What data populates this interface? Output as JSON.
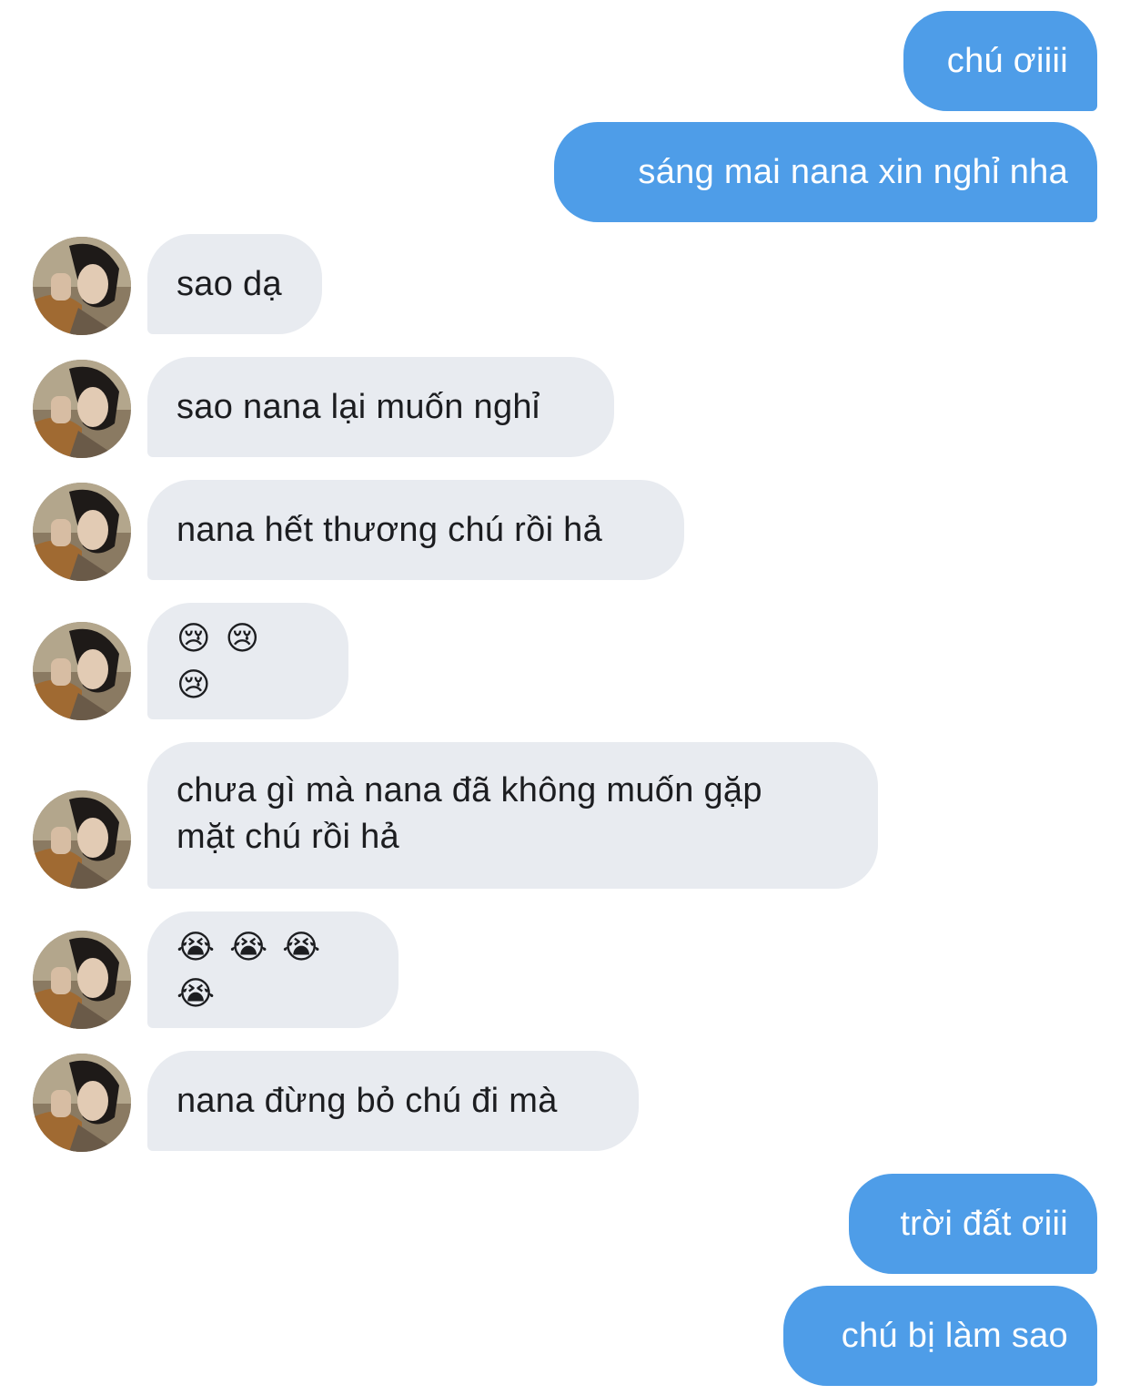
{
  "messages": [
    {
      "side": "sent",
      "text": "chú ơiiii"
    },
    {
      "side": "sent",
      "text": "sáng mai nana xin nghỉ nha"
    },
    {
      "side": "received",
      "text": "sao dạ"
    },
    {
      "side": "received",
      "text": "sao nana lại muốn nghỉ"
    },
    {
      "side": "received",
      "text": "nana hết thương chú rồi hả"
    },
    {
      "side": "received",
      "text": "😢😢😢"
    },
    {
      "side": "received",
      "text": "chưa gì mà nana đã không muốn gặp\nmặt chú rồi hả"
    },
    {
      "side": "received",
      "text": "😭😭😭😭"
    },
    {
      "side": "received",
      "text": "nana đừng bỏ chú đi mà"
    },
    {
      "side": "sent",
      "text": "trời đất ơiii"
    },
    {
      "side": "sent",
      "text": "chú bị làm sao"
    }
  ],
  "colors": {
    "sent_bubble": "#4e9de8",
    "received_bubble": "#e8ebf0",
    "sent_text": "#ffffff",
    "received_text": "#1c1d20"
  },
  "avatar": {
    "icon": "contact-avatar-photo"
  }
}
